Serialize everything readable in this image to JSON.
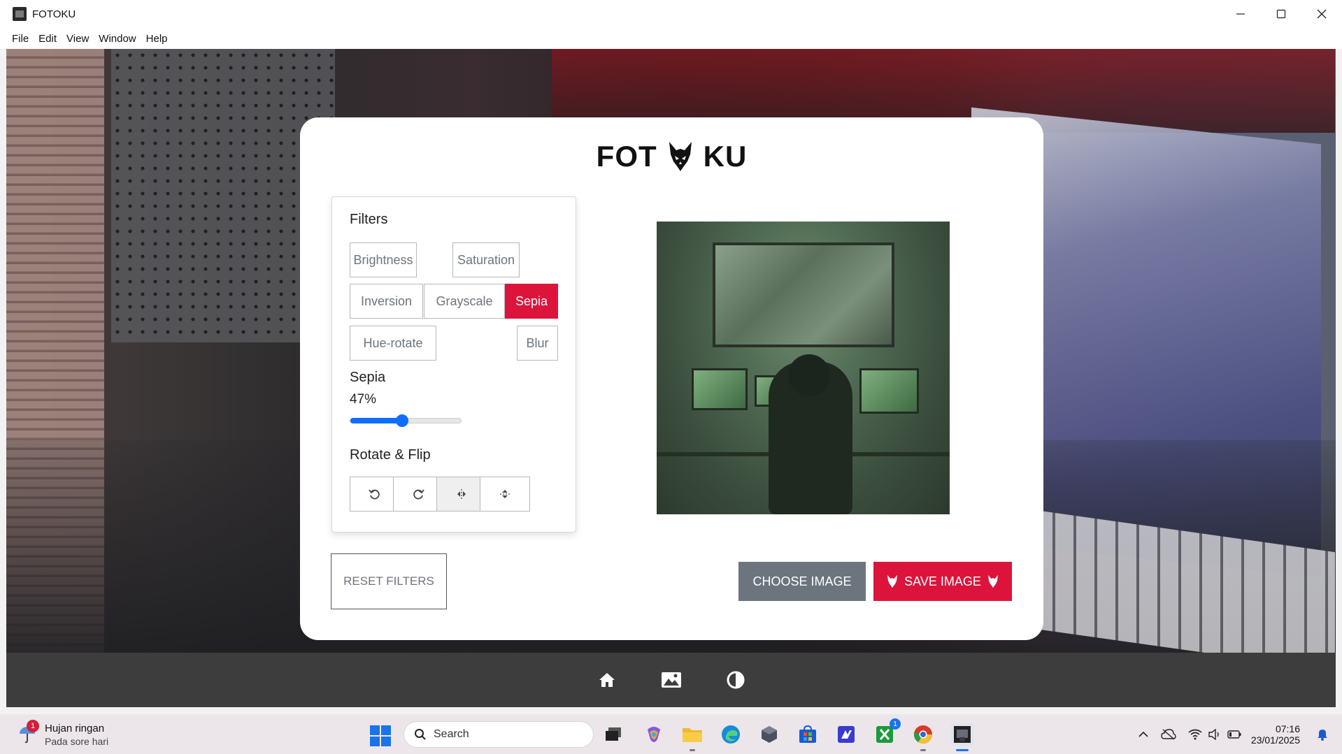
{
  "window": {
    "title": "FOTOKU",
    "controls": [
      "minimize-icon",
      "maximize-icon",
      "close-icon"
    ]
  },
  "menu": {
    "items": [
      "File",
      "Edit",
      "View",
      "Window",
      "Help"
    ]
  },
  "app": {
    "brand_left": "FOT",
    "brand_right": "KU",
    "filters_heading": "Filters",
    "filter_buttons": [
      {
        "label": "Brightness",
        "active": false
      },
      {
        "label": "Saturation",
        "active": false
      },
      {
        "label": "Inversion",
        "active": false
      },
      {
        "label": "Grayscale",
        "active": false
      },
      {
        "label": "Sepia",
        "active": true
      },
      {
        "label": "Hue-rotate",
        "active": false
      },
      {
        "label": "Blur",
        "active": false
      }
    ],
    "slider": {
      "name": "Sepia",
      "value_text": "47%",
      "value": 47,
      "color": "#0d6efd"
    },
    "rotate_heading": "Rotate & Flip",
    "rotate_buttons": [
      "rotate-left-icon",
      "rotate-right-icon",
      "flip-horizontal-icon",
      "flip-vertical-icon"
    ],
    "reset_label": "RESET FILTERS",
    "choose_label": "CHOOSE IMAGE",
    "save_label": "SAVE IMAGE",
    "accent_color": "#dc143c",
    "secondary_color": "#6c757d"
  },
  "bottom_nav": [
    "home-icon",
    "gallery-icon",
    "contrast-icon"
  ],
  "taskbar": {
    "weather_title": "Hujan ringan",
    "weather_subtitle": "Pada sore hari",
    "weather_badge": "1",
    "search_label": "Search",
    "apps": [
      "task-view-icon",
      "copilot-icon",
      "file-explorer-icon",
      "edge-icon",
      "app-cube-icon",
      "store-icon",
      "vscode-icon",
      "xbox-icon",
      "chrome-icon",
      "fotoku-icon"
    ],
    "xbox_badge": "1",
    "time": "07:16",
    "date": "23/01/2025"
  }
}
